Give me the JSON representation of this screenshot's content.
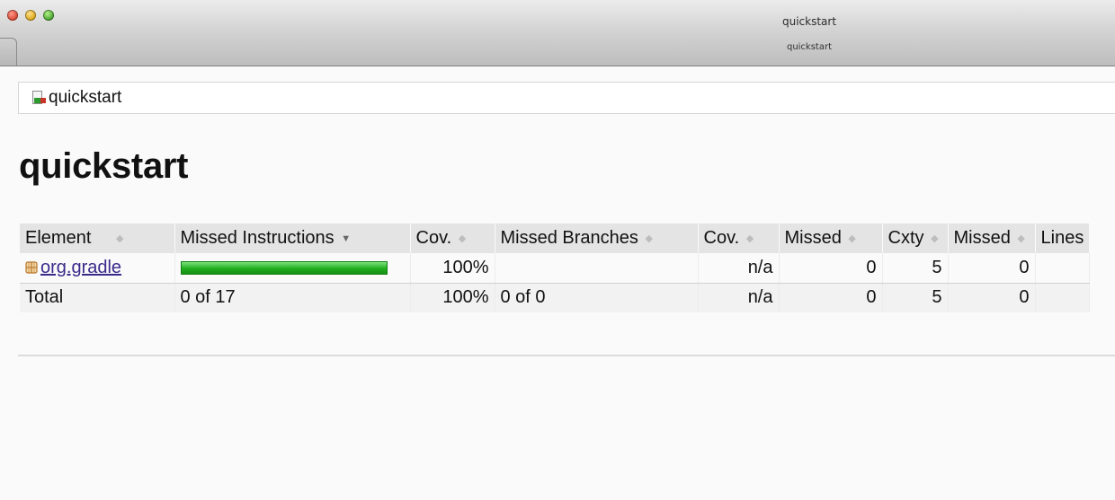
{
  "window": {
    "title": "quickstart",
    "tab_title": "quickstart"
  },
  "breadcrumb": {
    "label": "quickstart",
    "icon": "report-icon"
  },
  "page_title": "quickstart",
  "table": {
    "headers": {
      "element": "Element",
      "missed_instructions": "Missed Instructions",
      "cov1": "Cov.",
      "missed_branches": "Missed Branches",
      "cov2": "Cov.",
      "missed_cxty": "Missed",
      "cxty": "Cxty",
      "missed_lines": "Missed",
      "lines": "Lines"
    },
    "rows": [
      {
        "element": "org.gradle",
        "missed_instructions_coverage": 1.0,
        "cov1": "100%",
        "missed_branches": "",
        "cov2": "n/a",
        "missed_cxty": "0",
        "cxty": "5",
        "missed_lines": "0"
      }
    ],
    "total": {
      "label": "Total",
      "missed_instructions": "0 of 17",
      "cov1": "100%",
      "missed_branches": "0 of 0",
      "cov2": "n/a",
      "missed_cxty": "0",
      "cxty": "5",
      "missed_lines": "0"
    }
  },
  "colors": {
    "coverage_bar": "#1fae1f",
    "link": "#3b2a8a",
    "header_bg": "#e4e4e4"
  }
}
